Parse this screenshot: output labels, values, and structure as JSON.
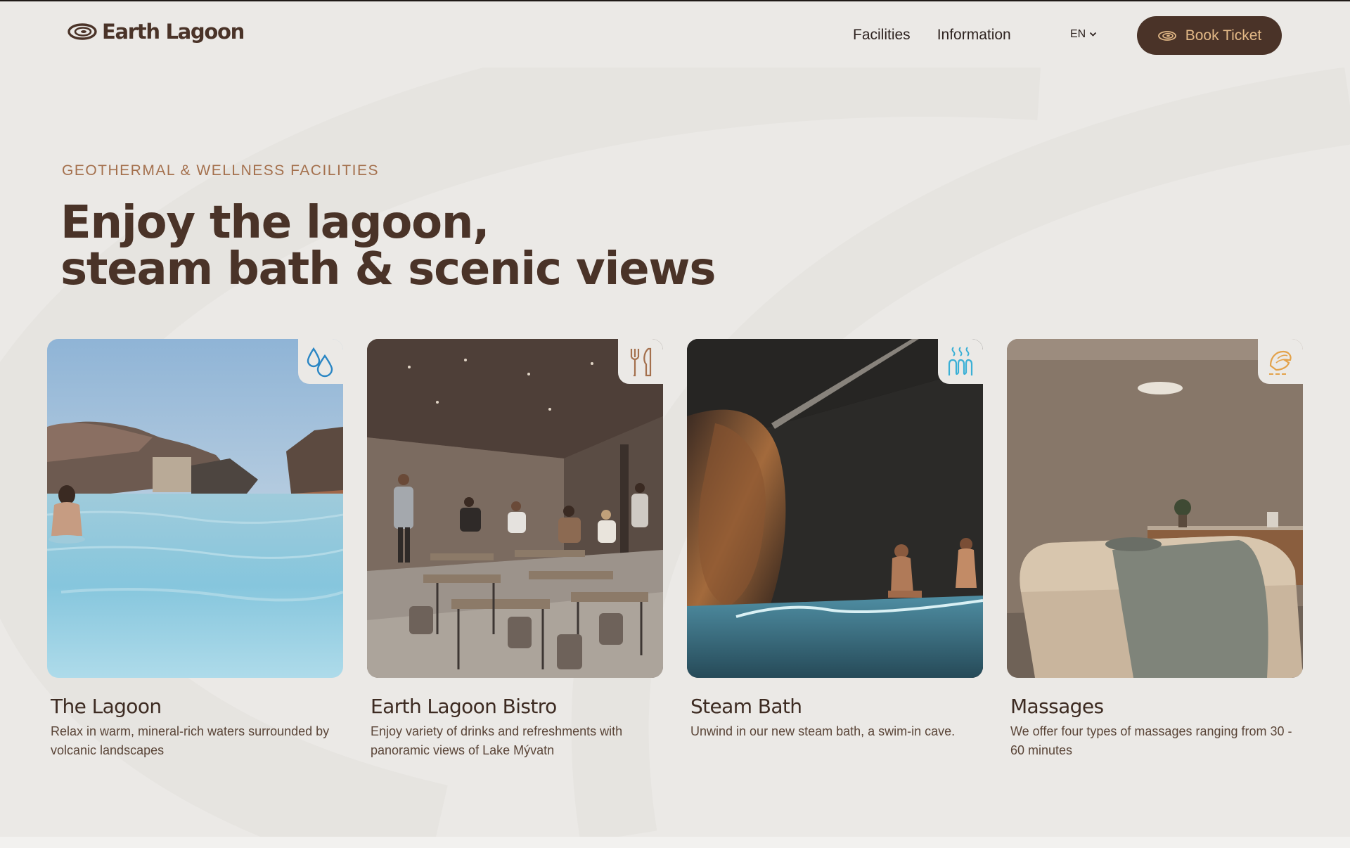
{
  "brand": {
    "name": "Earth Lagoon"
  },
  "nav": {
    "links": [
      "Facilities",
      "Information"
    ],
    "language": "EN",
    "cta_label": "Book Ticket"
  },
  "hero": {
    "eyebrow": "GEOTHERMAL & WELLNESS FACILITIES",
    "headline_line1": "Enjoy the lagoon,",
    "headline_line2": "steam bath & scenic views"
  },
  "facilities": [
    {
      "title": "The Lagoon",
      "description": "Relax in warm, mineral-rich waters surrounded by volcanic landscapes",
      "icon": "water-drops-icon",
      "icon_color": "#2a86c4"
    },
    {
      "title": "Earth Lagoon Bistro",
      "description": "Enjoy variety of drinks and refreshments with panoramic views of Lake Mývatn",
      "icon": "fork-knife-icon",
      "icon_color": "#a4704d"
    },
    {
      "title": "Steam Bath",
      "description": "Unwind in our new steam bath, a swim-in cave.",
      "icon": "steam-icon",
      "icon_color": "#3ab0d6"
    },
    {
      "title": "Massages",
      "description": "We offer four types of massages ranging from 30 - 60 minutes",
      "icon": "massage-hand-icon",
      "icon_color": "#e3a24a"
    }
  ],
  "colors": {
    "background": "#ebe9e6",
    "brand_brown": "#4a3328",
    "accent_gold": "#e3b987",
    "eyebrow": "#a4704d"
  }
}
